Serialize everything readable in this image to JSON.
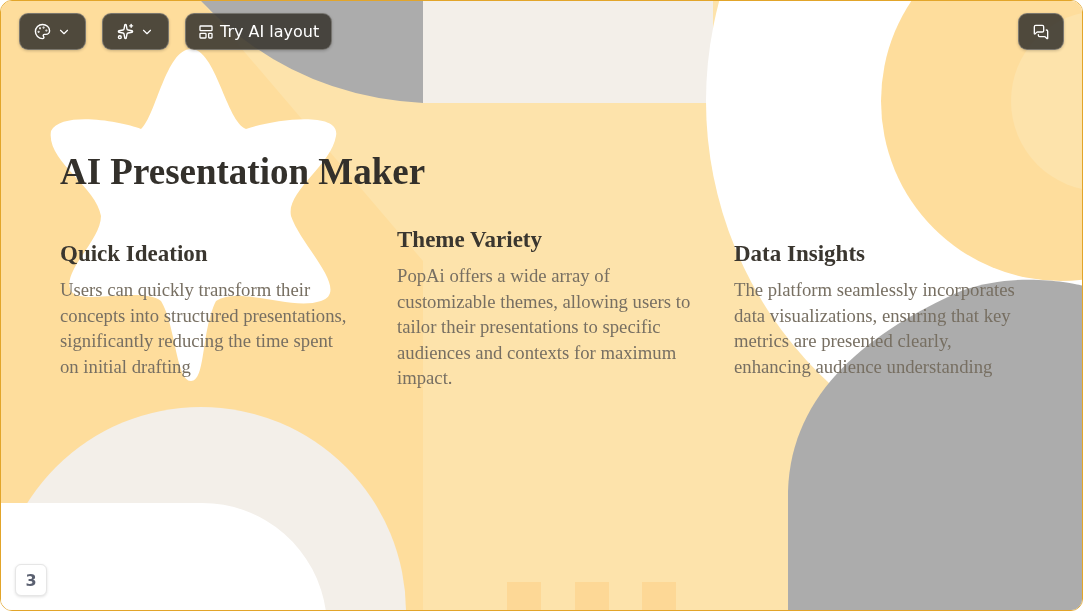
{
  "toolbar": {
    "buttons": [
      {
        "kind": "theme"
      },
      {
        "kind": "magic"
      },
      {
        "kind": "layout",
        "label": "Try AI layout"
      }
    ],
    "comments_button": {
      "kind": "comments"
    }
  },
  "slide": {
    "title": "AI Presentation Maker",
    "features": [
      {
        "heading": "Quick Ideation",
        "text": "Users can quickly transform their concepts into structured presentations, significantly reducing the time spent on initial drafting"
      },
      {
        "heading": "Theme Variety",
        "text": "PopAi offers a wide array of customizable themes, allowing users to tailor their presentations to specific audiences and contexts for maximum impact."
      },
      {
        "heading": "Data Insights",
        "text": "The platform seamlessly incorporates data visualizations, ensuring that key metrics are presented clearly, enhancing audience understanding"
      }
    ],
    "page_number": "3"
  }
}
